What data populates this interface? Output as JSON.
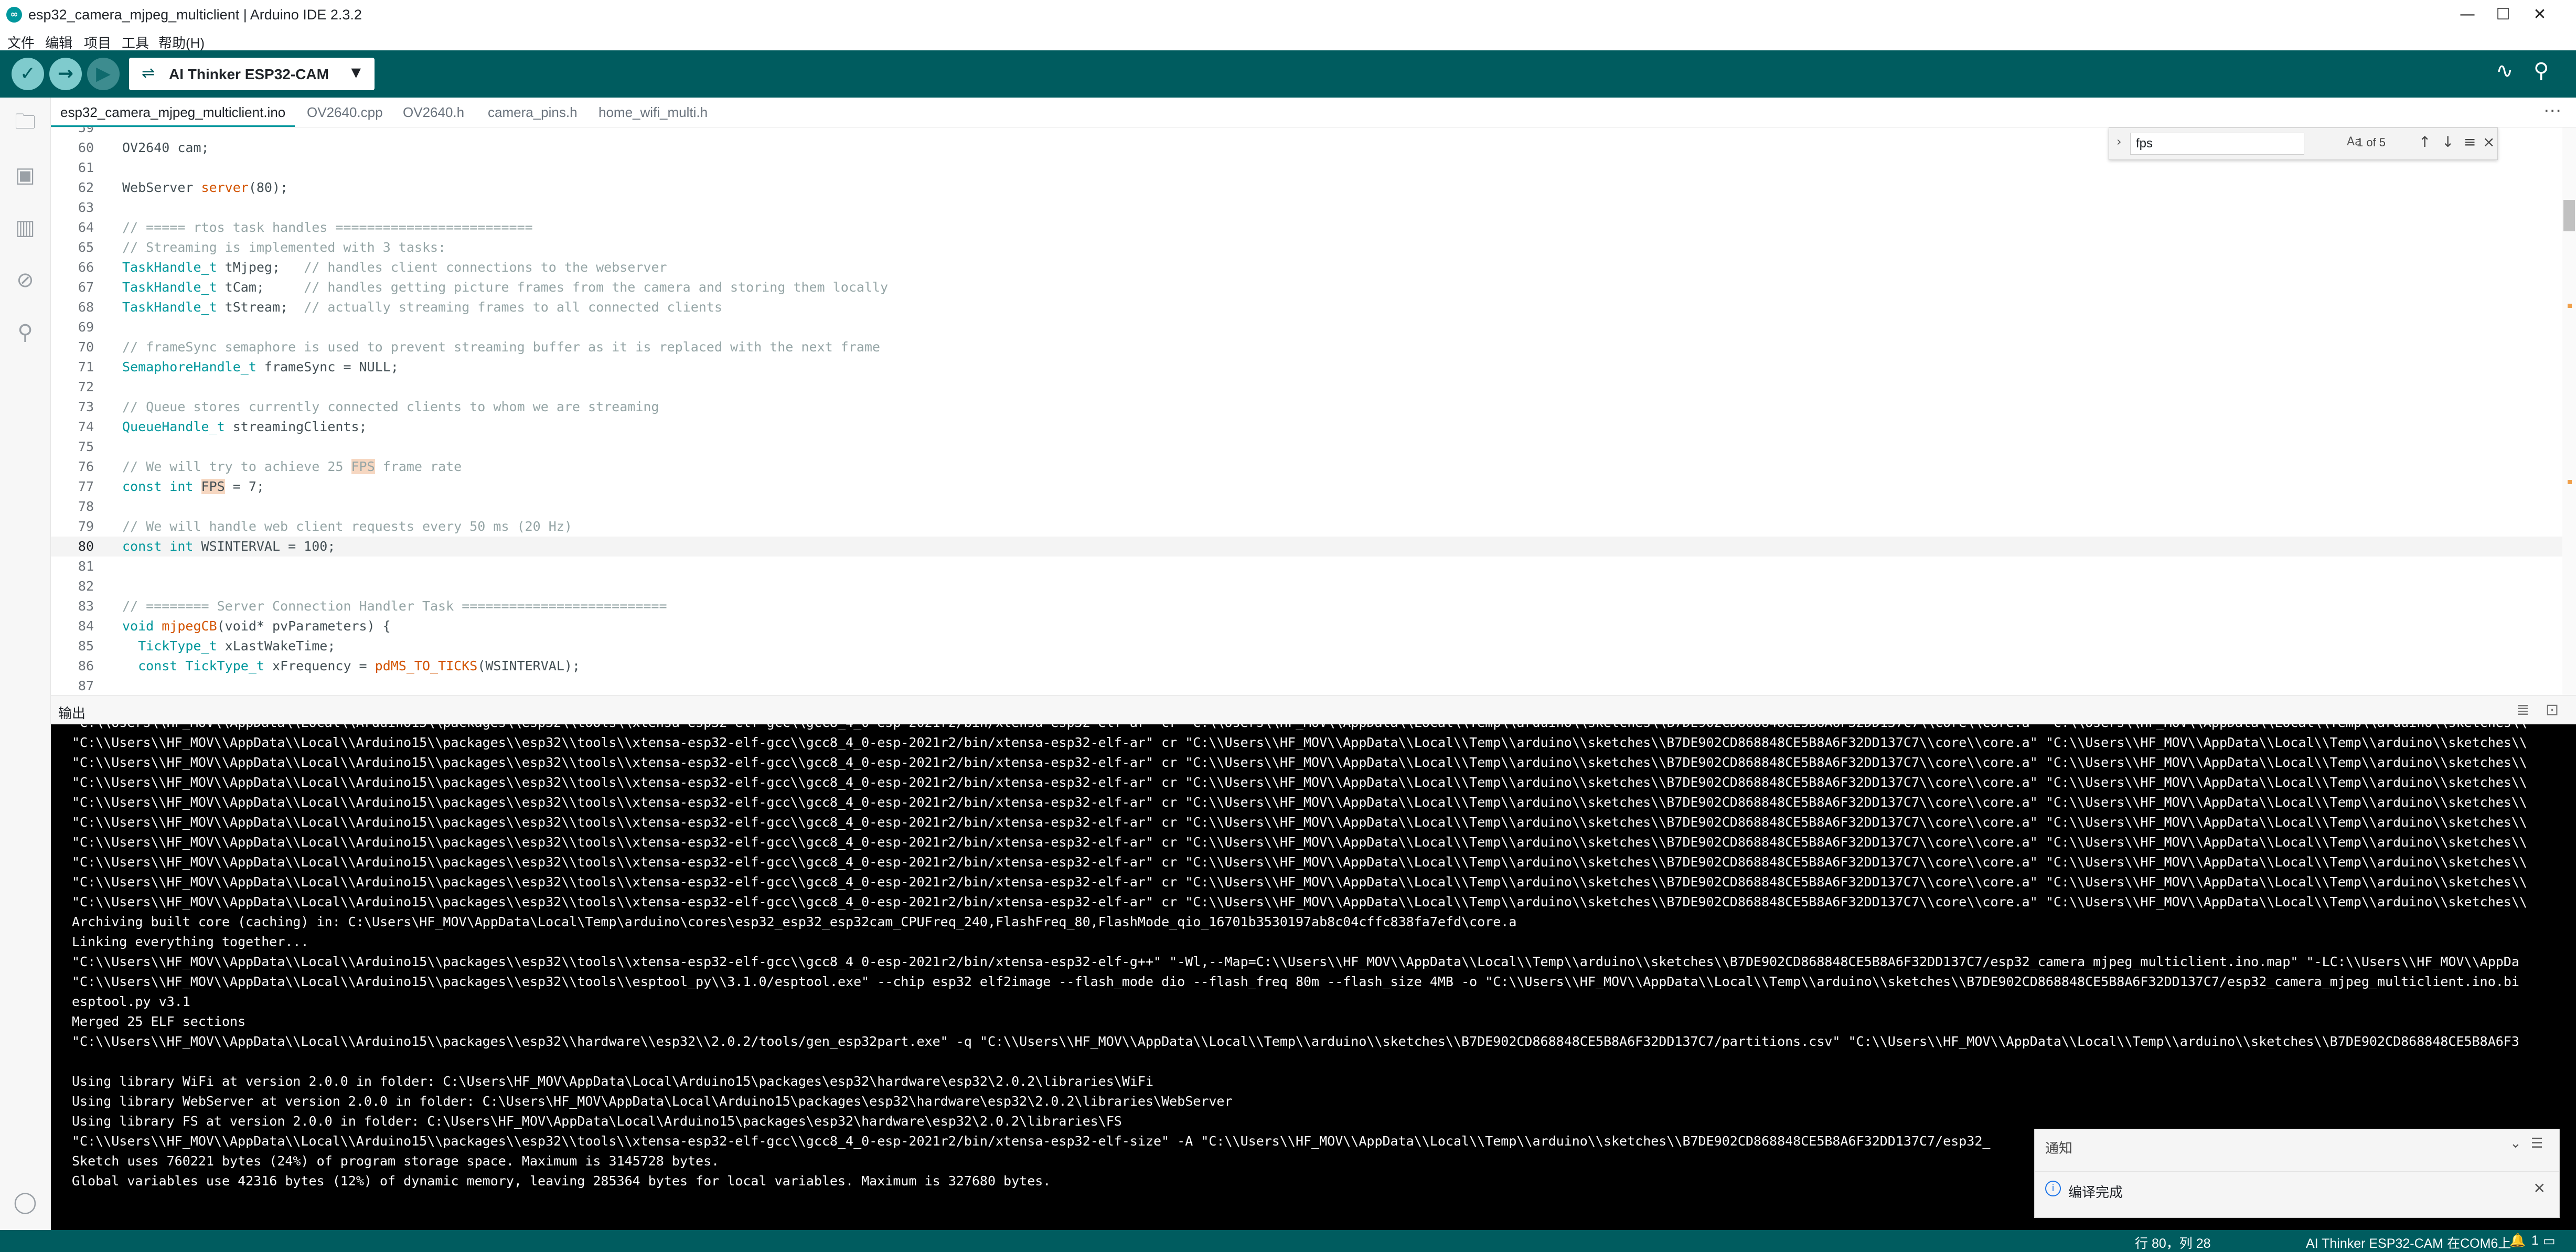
{
  "window": {
    "title": "esp32_camera_mjpeg_multiclient | Arduino IDE 2.3.2",
    "app_icon": "arduino-icon",
    "controls": {
      "minimize": "—",
      "maximize": "☐",
      "close": "✕"
    }
  },
  "menu": [
    "文件",
    "编辑",
    "项目",
    "工具",
    "帮助(H)"
  ],
  "toolbar": {
    "verify_icon": "✓",
    "upload_icon": "→",
    "debug_icon": "▶",
    "board": "AI Thinker ESP32-CAM",
    "board_icon": "usb-icon",
    "serial_plotter_icon": "∿",
    "serial_monitor_icon": "⚲"
  },
  "sidebar": [
    "folder-icon",
    "boards-manager-icon",
    "library-manager-icon",
    "debug-icon",
    "search-icon",
    "account-icon"
  ],
  "tabs": [
    "esp32_camera_mjpeg_multiclient.ino",
    "OV2640.cpp",
    "OV2640.h",
    "camera_pins.h",
    "home_wifi_multi.h"
  ],
  "find": {
    "query": "fps",
    "match_case": "Aa",
    "whole_word": "ab",
    "regex": ".*",
    "count": "1 of 5"
  },
  "editor": {
    "current_line": 80,
    "line_numbers": [
      "59",
      "60",
      "61",
      "62",
      "63",
      "64",
      "65",
      "66",
      "67",
      "68",
      "69",
      "70",
      "71",
      "72",
      "73",
      "74",
      "75",
      "76",
      "77",
      "78",
      "79",
      "80",
      "81",
      "82",
      "83",
      "84",
      "85",
      "86",
      "87"
    ],
    "lines": {
      "l60": "OV2640 cam;",
      "l62a": "WebServer ",
      "l62b": "server",
      "l62c": "(80);",
      "l64": "// ===== rtos task handles =========================",
      "l65": "// Streaming is implemented with 3 tasks:",
      "l66a": "TaskHandle_t",
      "l66b": " tMjpeg;   ",
      "l66c": "// handles client connections to the webserver",
      "l67a": "TaskHandle_t",
      "l67b": " tCam;     ",
      "l67c": "// handles getting picture frames from the camera and storing them locally",
      "l68a": "TaskHandle_t",
      "l68b": " tStream;  ",
      "l68c": "// actually streaming frames to all connected clients",
      "l70": "// frameSync semaphore is used to prevent streaming buffer as it is replaced with the next frame",
      "l71a": "SemaphoreHandle_t",
      "l71b": " frameSync = NULL;",
      "l73": "// Queue stores currently connected clients to whom we are streaming",
      "l74a": "QueueHandle_t",
      "l74b": " streamingClients;",
      "l76a": "// We will try to achieve 25 ",
      "l76b": "FPS",
      "l76c": " frame rate",
      "l77a": "const int ",
      "l77b": "FPS",
      "l77c": " = 7;",
      "l79": "// We will handle web client requests every 50 ms (20 Hz)",
      "l80a": "const int",
      "l80b": " WSINTERVAL = 100;",
      "l83": "// ======== Server Connection Handler Task ==========================",
      "l84a": "void ",
      "l84b": "mjpegCB",
      "l84c": "(void* pvParameters) {",
      "l85a": "  TickType_t",
      "l85b": " xLastWakeTime;",
      "l86a": "  const ",
      "l86b": "TickType_t",
      "l86c": " xFrequency = ",
      "l86d": "pdMS_TO_TICKS",
      "l86e": "(WSINTERVAL);"
    }
  },
  "output": {
    "label": "输出",
    "lines": [
      "\"C:\\\\Users\\\\HF_MOV\\\\AppData\\\\Local\\\\Arduino15\\\\packages\\\\esp32\\\\tools\\\\xtensa-esp32-elf-gcc\\\\gcc8_4_0-esp-2021r2/bin/xtensa-esp32-elf-ar\" cr \"C:\\\\Users\\\\HF_MOV\\\\AppData\\\\Local\\\\Temp\\\\arduino\\\\sketches\\\\B7DE902CD868848CE5B8A6F32DD137C7\\\\core\\\\core.a\" \"C:\\\\Users\\\\HF_MOV\\\\AppData\\\\Local\\\\Temp\\\\arduino\\\\sketches\\\\",
      "\"C:\\\\Users\\\\HF_MOV\\\\AppData\\\\Local\\\\Arduino15\\\\packages\\\\esp32\\\\tools\\\\xtensa-esp32-elf-gcc\\\\gcc8_4_0-esp-2021r2/bin/xtensa-esp32-elf-ar\" cr \"C:\\\\Users\\\\HF_MOV\\\\AppData\\\\Local\\\\Temp\\\\arduino\\\\sketches\\\\B7DE902CD868848CE5B8A6F32DD137C7\\\\core\\\\core.a\" \"C:\\\\Users\\\\HF_MOV\\\\AppData\\\\Local\\\\Temp\\\\arduino\\\\sketches\\\\",
      "\"C:\\\\Users\\\\HF_MOV\\\\AppData\\\\Local\\\\Arduino15\\\\packages\\\\esp32\\\\tools\\\\xtensa-esp32-elf-gcc\\\\gcc8_4_0-esp-2021r2/bin/xtensa-esp32-elf-ar\" cr \"C:\\\\Users\\\\HF_MOV\\\\AppData\\\\Local\\\\Temp\\\\arduino\\\\sketches\\\\B7DE902CD868848CE5B8A6F32DD137C7\\\\core\\\\core.a\" \"C:\\\\Users\\\\HF_MOV\\\\AppData\\\\Local\\\\Temp\\\\arduino\\\\sketches\\\\",
      "\"C:\\\\Users\\\\HF_MOV\\\\AppData\\\\Local\\\\Arduino15\\\\packages\\\\esp32\\\\tools\\\\xtensa-esp32-elf-gcc\\\\gcc8_4_0-esp-2021r2/bin/xtensa-esp32-elf-ar\" cr \"C:\\\\Users\\\\HF_MOV\\\\AppData\\\\Local\\\\Temp\\\\arduino\\\\sketches\\\\B7DE902CD868848CE5B8A6F32DD137C7\\\\core\\\\core.a\" \"C:\\\\Users\\\\HF_MOV\\\\AppData\\\\Local\\\\Temp\\\\arduino\\\\sketches\\\\",
      "\"C:\\\\Users\\\\HF_MOV\\\\AppData\\\\Local\\\\Arduino15\\\\packages\\\\esp32\\\\tools\\\\xtensa-esp32-elf-gcc\\\\gcc8_4_0-esp-2021r2/bin/xtensa-esp32-elf-ar\" cr \"C:\\\\Users\\\\HF_MOV\\\\AppData\\\\Local\\\\Temp\\\\arduino\\\\sketches\\\\B7DE902CD868848CE5B8A6F32DD137C7\\\\core\\\\core.a\" \"C:\\\\Users\\\\HF_MOV\\\\AppData\\\\Local\\\\Temp\\\\arduino\\\\sketches\\\\",
      "\"C:\\\\Users\\\\HF_MOV\\\\AppData\\\\Local\\\\Arduino15\\\\packages\\\\esp32\\\\tools\\\\xtensa-esp32-elf-gcc\\\\gcc8_4_0-esp-2021r2/bin/xtensa-esp32-elf-ar\" cr \"C:\\\\Users\\\\HF_MOV\\\\AppData\\\\Local\\\\Temp\\\\arduino\\\\sketches\\\\B7DE902CD868848CE5B8A6F32DD137C7\\\\core\\\\core.a\" \"C:\\\\Users\\\\HF_MOV\\\\AppData\\\\Local\\\\Temp\\\\arduino\\\\sketches\\\\",
      "\"C:\\\\Users\\\\HF_MOV\\\\AppData\\\\Local\\\\Arduino15\\\\packages\\\\esp32\\\\tools\\\\xtensa-esp32-elf-gcc\\\\gcc8_4_0-esp-2021r2/bin/xtensa-esp32-elf-ar\" cr \"C:\\\\Users\\\\HF_MOV\\\\AppData\\\\Local\\\\Temp\\\\arduino\\\\sketches\\\\B7DE902CD868848CE5B8A6F32DD137C7\\\\core\\\\core.a\" \"C:\\\\Users\\\\HF_MOV\\\\AppData\\\\Local\\\\Temp\\\\arduino\\\\sketches\\\\",
      "\"C:\\\\Users\\\\HF_MOV\\\\AppData\\\\Local\\\\Arduino15\\\\packages\\\\esp32\\\\tools\\\\xtensa-esp32-elf-gcc\\\\gcc8_4_0-esp-2021r2/bin/xtensa-esp32-elf-ar\" cr \"C:\\\\Users\\\\HF_MOV\\\\AppData\\\\Local\\\\Temp\\\\arduino\\\\sketches\\\\B7DE902CD868848CE5B8A6F32DD137C7\\\\core\\\\core.a\" \"C:\\\\Users\\\\HF_MOV\\\\AppData\\\\Local\\\\Temp\\\\arduino\\\\sketches\\\\",
      "\"C:\\\\Users\\\\HF_MOV\\\\AppData\\\\Local\\\\Arduino15\\\\packages\\\\esp32\\\\tools\\\\xtensa-esp32-elf-gcc\\\\gcc8_4_0-esp-2021r2/bin/xtensa-esp32-elf-ar\" cr \"C:\\\\Users\\\\HF_MOV\\\\AppData\\\\Local\\\\Temp\\\\arduino\\\\sketches\\\\B7DE902CD868848CE5B8A6F32DD137C7\\\\core\\\\core.a\" \"C:\\\\Users\\\\HF_MOV\\\\AppData\\\\Local\\\\Temp\\\\arduino\\\\sketches\\\\",
      "Archiving built core (caching) in: C:\\Users\\HF_MOV\\AppData\\Local\\Temp\\arduino\\cores\\esp32_esp32_esp32cam_CPUFreq_240,FlashFreq_80,FlashMode_qio_16701b3530197ab8c04cffc838fa7efd\\core.a",
      "Linking everything together...",
      "\"C:\\\\Users\\\\HF_MOV\\\\AppData\\\\Local\\\\Arduino15\\\\packages\\\\esp32\\\\tools\\\\xtensa-esp32-elf-gcc\\\\gcc8_4_0-esp-2021r2/bin/xtensa-esp32-elf-g++\" \"-Wl,--Map=C:\\\\Users\\\\HF_MOV\\\\AppData\\\\Local\\\\Temp\\\\arduino\\\\sketches\\\\B7DE902CD868848CE5B8A6F32DD137C7/esp32_camera_mjpeg_multiclient.ino.map\" \"-LC:\\\\Users\\\\HF_MOV\\\\AppDa",
      "\"C:\\\\Users\\\\HF_MOV\\\\AppData\\\\Local\\\\Arduino15\\\\packages\\\\esp32\\\\tools\\\\esptool_py\\\\3.1.0/esptool.exe\" --chip esp32 elf2image --flash_mode dio --flash_freq 80m --flash_size 4MB -o \"C:\\\\Users\\\\HF_MOV\\\\AppData\\\\Local\\\\Temp\\\\arduino\\\\sketches\\\\B7DE902CD868848CE5B8A6F32DD137C7/esp32_camera_mjpeg_multiclient.ino.bi",
      "esptool.py v3.1",
      "Merged 25 ELF sections",
      "\"C:\\\\Users\\\\HF_MOV\\\\AppData\\\\Local\\\\Arduino15\\\\packages\\\\esp32\\\\hardware\\\\esp32\\\\2.0.2/tools/gen_esp32part.exe\" -q \"C:\\\\Users\\\\HF_MOV\\\\AppData\\\\Local\\\\Temp\\\\arduino\\\\sketches\\\\B7DE902CD868848CE5B8A6F32DD137C7/partitions.csv\" \"C:\\\\Users\\\\HF_MOV\\\\AppData\\\\Local\\\\Temp\\\\arduino\\\\sketches\\\\B7DE902CD868848CE5B8A6F3",
      "",
      "Using library WiFi at version 2.0.0 in folder: C:\\Users\\HF_MOV\\AppData\\Local\\Arduino15\\packages\\esp32\\hardware\\esp32\\2.0.2\\libraries\\WiFi",
      "Using library WebServer at version 2.0.0 in folder: C:\\Users\\HF_MOV\\AppData\\Local\\Arduino15\\packages\\esp32\\hardware\\esp32\\2.0.2\\libraries\\WebServer",
      "Using library FS at version 2.0.0 in folder: C:\\Users\\HF_MOV\\AppData\\Local\\Arduino15\\packages\\esp32\\hardware\\esp32\\2.0.2\\libraries\\FS",
      "\"C:\\\\Users\\\\HF_MOV\\\\AppData\\\\Local\\\\Arduino15\\\\packages\\\\esp32\\\\tools\\\\xtensa-esp32-elf-gcc\\\\gcc8_4_0-esp-2021r2/bin/xtensa-esp32-elf-size\" -A \"C:\\\\Users\\\\HF_MOV\\\\AppData\\\\Local\\\\Temp\\\\arduino\\\\sketches\\\\B7DE902CD868848CE5B8A6F32DD137C7/esp32_",
      "Sketch uses 760221 bytes (24%) of program storage space. Maximum is 3145728 bytes.",
      "Global variables use 42316 bytes (12%) of dynamic memory, leaving 285364 bytes for local variables. Maximum is 327680 bytes."
    ]
  },
  "notification": {
    "title": "通知",
    "message": "编译完成"
  },
  "status": {
    "position": "行 80，列 28",
    "board_port": "AI Thinker ESP32-CAM 在COM6上",
    "count": "1"
  }
}
